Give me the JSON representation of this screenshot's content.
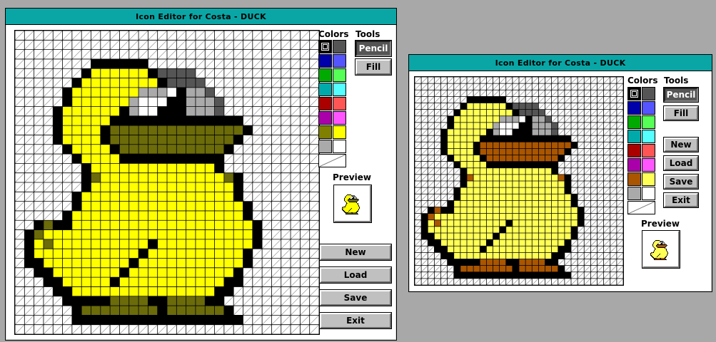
{
  "windows": [
    {
      "title": "Icon Editor for Costa - DUCK",
      "colors_label": "Colors",
      "tools_label": "Tools",
      "tools": {
        "pencil": "Pencil",
        "fill": "Fill"
      },
      "preview_label": "Preview",
      "actions": {
        "new": "New",
        "load": "Load",
        "save": "Save",
        "exit": "Exit"
      },
      "palette": [
        [
          "#000000",
          "#555555"
        ],
        [
          "#0000aa",
          "#5555ff"
        ],
        [
          "#00aa00",
          "#55ff55"
        ],
        [
          "#00aaaa",
          "#55ffff"
        ],
        [
          "#aa0000",
          "#ff5555"
        ],
        [
          "#aa00aa",
          "#ff55ff"
        ],
        [
          "#808000",
          "#ffff00"
        ],
        [
          "#aaaaaa",
          "#ffffff"
        ]
      ],
      "selected_color": "#000000",
      "active_tool": "Pencil",
      "brown_color": "#6b6b0a"
    },
    {
      "title": "Icon Editor for Costa - DUCK",
      "colors_label": "Colors",
      "tools_label": "Tools",
      "tools": {
        "pencil": "Pencil",
        "fill": "Fill"
      },
      "preview_label": "Preview",
      "actions": {
        "new": "New",
        "load": "Load",
        "save": "Save",
        "exit": "Exit"
      },
      "palette": [
        [
          "#000000",
          "#555555"
        ],
        [
          "#0000aa",
          "#5555ff"
        ],
        [
          "#00aa00",
          "#55ff55"
        ],
        [
          "#00aaaa",
          "#55ffff"
        ],
        [
          "#aa0000",
          "#ff5555"
        ],
        [
          "#aa00aa",
          "#ff55ff"
        ],
        [
          "#aa5500",
          "#ffff55"
        ],
        [
          "#aaaaaa",
          "#ffffff"
        ]
      ],
      "selected_color": "#000000",
      "active_tool": "Pencil",
      "brown_color": "#aa5500"
    }
  ],
  "icon": {
    "grid_size": 32,
    "legend": {
      ".": "transparent",
      "K": "#000000",
      "Y": "yellow",
      "B": "bill/feet color",
      "G": "#555555",
      "L": "#aaaaaa",
      "W": "#ffffff"
    },
    "rows": [
      "................................",
      "................................",
      "................................",
      "........KKKKKK..................",
      ".......KYYYYYYKGGGG.............",
      "......KYYYYYYYYKGGGG............",
      ".....KYYYYYYYLLLWKLLG...........",
      ".....KYYYYYYLWWWKKLLLG..........",
      "....KYYYYYYKLWWKKKLLLG..........",
      "....KYYYYYKKKKKKKKKKKKKK........",
      "....KYYYYKBBBBBBBBBBBBBBK.......",
      "....KYYYYKBBBBBBBBBBBBBK........",
      ".....KYYYYKBBBBBBBBBBBK.........",
      "......KYYYYKKKKKKKKKKK..........",
      ".......KYYYYYYYYYYYYYK..........",
      ".......KBYYYYYYYYYYYYYBK........",
      ".......KYYYYYYYYYYYYYYYK........",
      "......KYYYYYYYYYYYYYYYYK........",
      "......KYYYYYYYYYYYYYYYYYK.......",
      ".....KYYYYYYYYYYYYYYYYYYK.......",
      "..KBKKYYYYYYYYYYYYYYYYYYYK......",
      ".KBYYYYYYYYYYYYYYYYYYYYYYK......",
      ".KYBYYYYYYYYYYKYYYYYYYYYYK......",
      ".KYYYYYYYYYYYKYYYYYYYYYYK.......",
      ".KKYYYYYYYYYKYYYYYYYYYYYK.......",
      "..KKYYYYYYYKYYYYYYYYYYYK........",
      "...KKYYYYYKYYYYYYYYYYYKK........",
      "....KKYYYYYYYYYYYYYYYKK.........",
      ".....KKKKKBBBBKKBBBBKK..........",
      "......KBBBBBBBBKBBBBBBK.........",
      "......KKKKKKKKKKKKKKKKKK........",
      "................................"
    ]
  }
}
